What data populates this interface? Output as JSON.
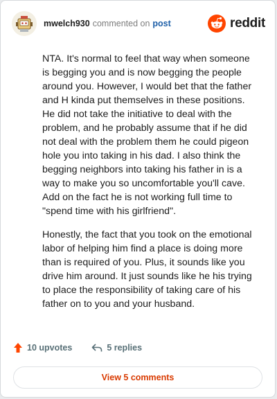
{
  "header": {
    "username": "mwelch930",
    "commented_text": "commented on",
    "post_link": "post",
    "brand": "reddit",
    "brand_color": "#ff4500"
  },
  "comment": {
    "paragraphs": [
      "NTA. It's normal to feel that way when someone is begging you and is now begging the people around you. However, I would bet that the father and H kinda put themselves in these positions. He did not take the initiative to deal with the problem, and he probably assume that if he did not deal with the problem them he could pigeon hole you into taking in his dad. I also think the begging neighbors into taking his father in is a way to make you so uncomfortable you'll cave. Add on the fact he is not working full time to \"spend time with his girlfriend\".",
      "Honestly, the fact that you took on the emotional labor of helping him find a place is doing more than is required of you. Plus, it sounds like you drive him around. It just sounds like he his trying to place the responsibility of taking care of his father on to you and your husband."
    ]
  },
  "actions": {
    "upvotes_label": "10 upvotes",
    "replies_label": "5 replies",
    "upvote_icon": "upvote-arrow-icon",
    "reply_icon": "reply-arrow-icon",
    "upvote_color": "#ff4500"
  },
  "footer": {
    "view_comments_label": "View 5 comments"
  }
}
